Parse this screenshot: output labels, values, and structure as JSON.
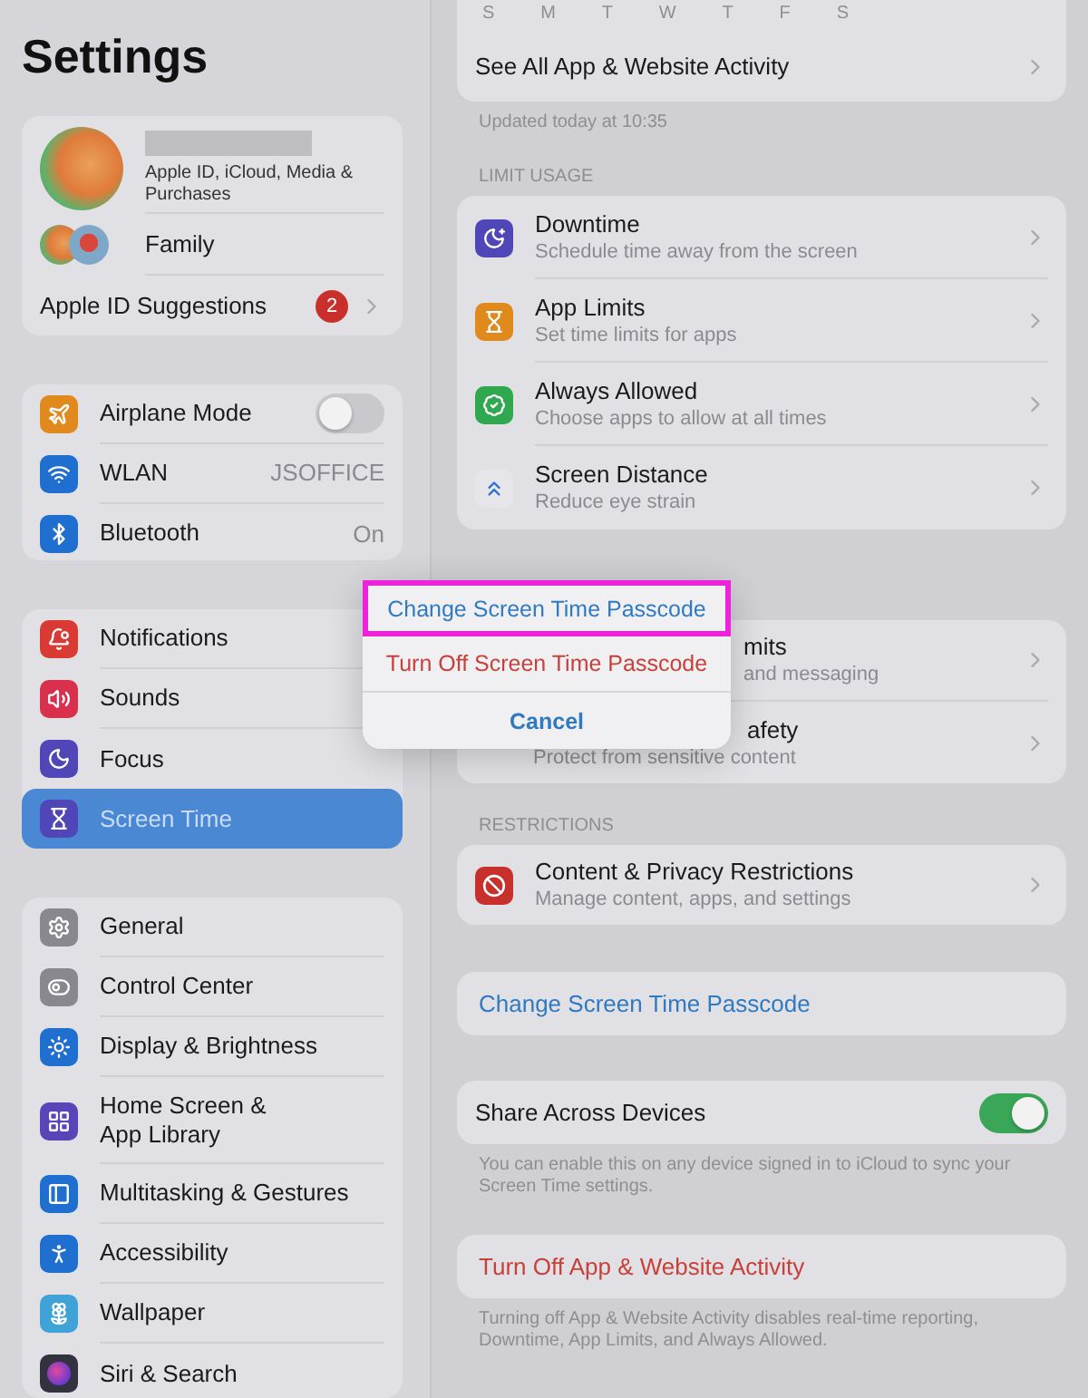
{
  "sidebar": {
    "title": "Settings",
    "account": {
      "subtitle": "Apple ID, iCloud, Media & Purchases",
      "family": "Family",
      "suggestions": "Apple ID Suggestions",
      "badge": "2"
    },
    "groups": [
      {
        "items": [
          {
            "label": "Airplane Mode",
            "color": "#e08a1e",
            "toggle": {
              "on": false
            }
          },
          {
            "label": "WLAN",
            "color": "#1f6fd0",
            "value": "JSOFFICE"
          },
          {
            "label": "Bluetooth",
            "color": "#1f6fd0",
            "value": "On"
          }
        ]
      },
      {
        "items": [
          {
            "label": "Notifications",
            "color": "#d93a34",
            "selected": false
          },
          {
            "label": "Sounds",
            "color": "#d9304e",
            "selected": false
          },
          {
            "label": "Focus",
            "color": "#5046b8",
            "selected": false
          },
          {
            "label": "Screen Time",
            "color": "#5046b8",
            "selected": true
          }
        ]
      },
      {
        "items": [
          {
            "label": "General",
            "color": "#88888e"
          },
          {
            "label": "Control Center",
            "color": "#88888e"
          },
          {
            "label": "Display & Brightness",
            "color": "#1f6fd0"
          },
          {
            "label": "Home Screen & App Library",
            "color": "#5a44b8"
          },
          {
            "label": "Multitasking & Gestures",
            "color": "#1f6fd0"
          },
          {
            "label": "Accessibility",
            "color": "#1f6fd0"
          },
          {
            "label": "Wallpaper",
            "color": "#3fa3d8"
          },
          {
            "label": "Siri & Search",
            "color": "#333340"
          }
        ]
      }
    ]
  },
  "detail": {
    "days": [
      "S",
      "M",
      "T",
      "W",
      "T",
      "F",
      "S"
    ],
    "see_all": "See All App & Website Activity",
    "updated": "Updated today at 10:35",
    "limit_header": "LIMIT USAGE",
    "limit_rows": [
      {
        "title": "Downtime",
        "subtitle": "Schedule time away from the screen",
        "color": "#5046b8"
      },
      {
        "title": "App Limits",
        "subtitle": "Set time limits for apps",
        "color": "#e08a1e"
      },
      {
        "title": "Always Allowed",
        "subtitle": "Choose apps to allow at all times",
        "color": "#2fa84f"
      },
      {
        "title": "Screen Distance",
        "subtitle": "Reduce eye strain",
        "color": "#e6e6ea"
      }
    ],
    "covered_rows": [
      {
        "title": "mits",
        "subtitle": "and messaging"
      },
      {
        "title": "afety",
        "subtitle": "Protect from sensitive content"
      }
    ],
    "restrictions_header": "RESTRICTIONS",
    "restrictions": {
      "title": "Content & Privacy Restrictions",
      "subtitle": "Manage content, apps, and settings"
    },
    "change_passcode": "Change Screen Time Passcode",
    "share": {
      "label": "Share Across Devices",
      "on": true,
      "note": "You can enable this on any device signed in to iCloud to sync your Screen Time settings."
    },
    "turn_off": {
      "label": "Turn Off App & Website Activity",
      "note": "Turning off App & Website Activity disables real-time reporting, Downtime, App Limits, and Always Allowed."
    }
  },
  "popover": {
    "items": [
      {
        "label": "Change Screen Time Passcode",
        "kind": "action",
        "highlighted": true
      },
      {
        "label": "Turn Off Screen Time Passcode",
        "kind": "destructive",
        "highlighted": false
      },
      {
        "label": "Cancel",
        "kind": "cancel",
        "highlighted": false
      }
    ]
  }
}
